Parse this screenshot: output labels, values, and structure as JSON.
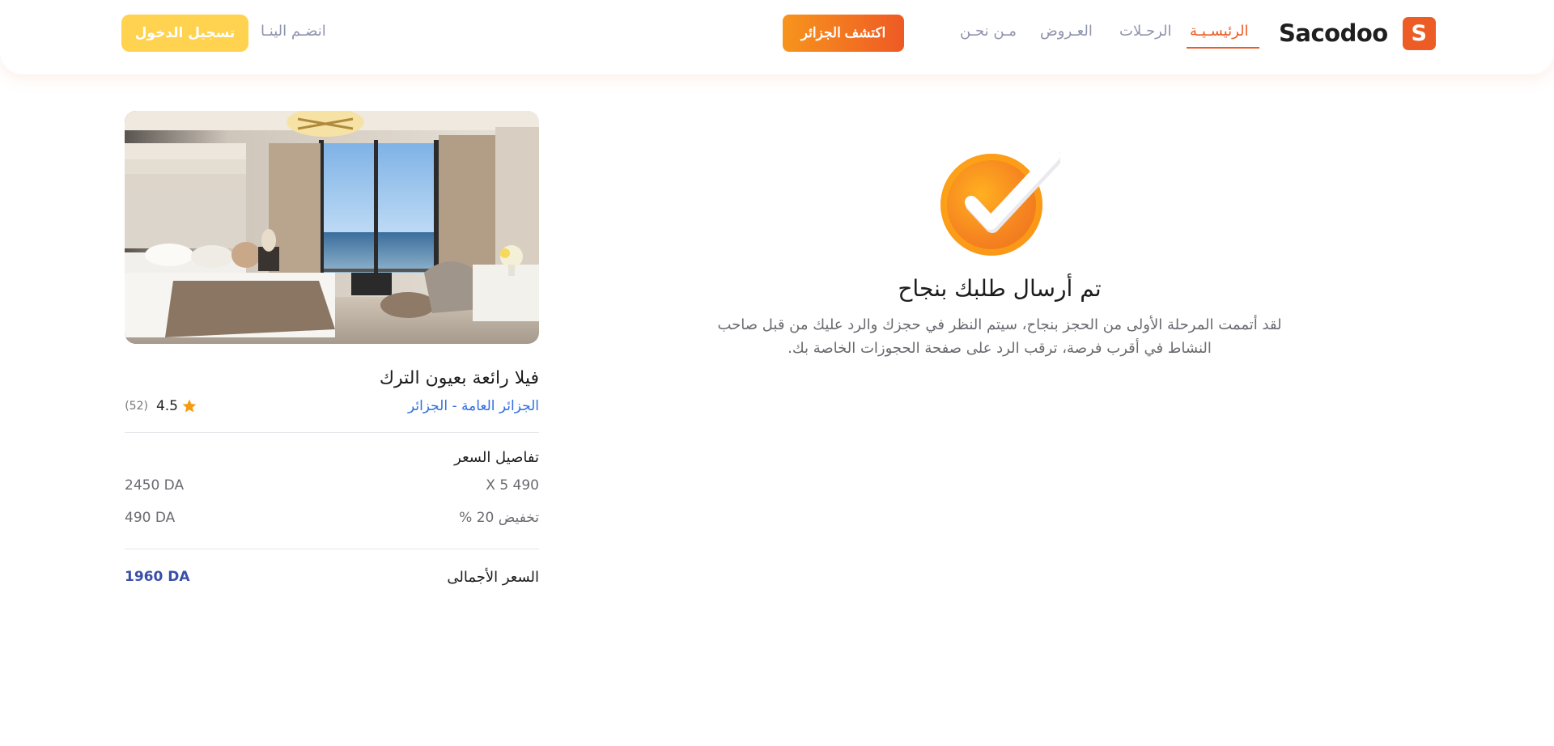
{
  "navbar": {
    "logo_letter": "S",
    "logo_text": "Sacodoo",
    "links": [
      {
        "label": "الرئيسـيـة",
        "active": true
      },
      {
        "label": "الرحـلات",
        "active": false
      },
      {
        "label": "العـروض",
        "active": false
      },
      {
        "label": "مـن نحـن",
        "active": false
      }
    ],
    "discover_label": "اكتشف الجزائر",
    "join_label": "انضـم الينـا",
    "login_label": "تسجيل الدخول"
  },
  "success": {
    "icon": "check-circle-icon",
    "title": "تم أرسال طلبك بنجاح",
    "message": "لقد أتممت المرحلة الأولى من الحجز بنجاح، سيتم النظر في حجزك والرد عليك من قبل صاحب النشاط في أقرب فرصة، ترقب الرد على صفحة الحجوزات الخاصة بك."
  },
  "booking": {
    "title": "فيلا رائعة بعيون الترك",
    "location": "الجزائر العامة - الجزائر",
    "rating": "4.5",
    "rating_count": "(52)",
    "price_section_title": "تفاصيل السعر",
    "rows": [
      {
        "label": "490 X 5",
        "amount": "2450 DA"
      },
      {
        "label": "تخفيض 20 %",
        "amount": "490 DA"
      }
    ],
    "total_label": "السعر الأجمالى",
    "total_amount": "1960 DA"
  },
  "colors": {
    "accent": "#ec5c24",
    "login_button": "#ffd24f",
    "link_blue": "#2f6fe0",
    "total_blue": "#3b4fa8"
  }
}
